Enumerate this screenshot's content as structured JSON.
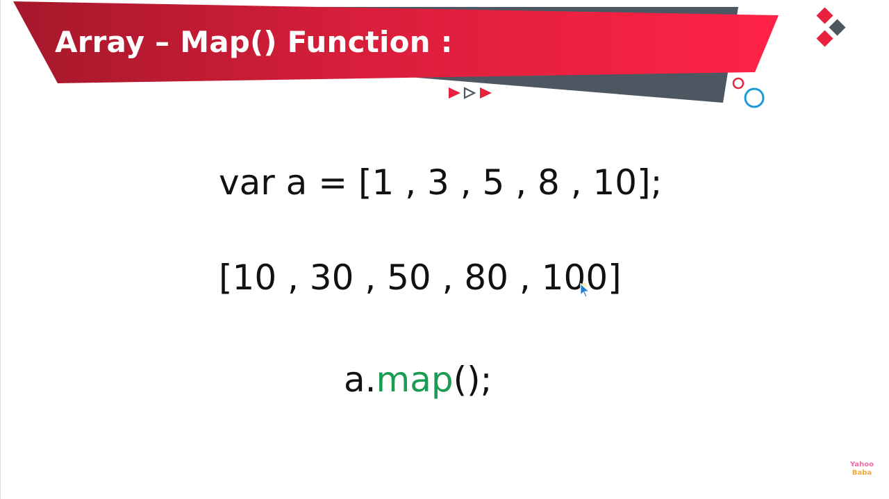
{
  "slide": {
    "title": "Array – Map() Function :",
    "code": {
      "line1": "var a = [1 , 3 , 5 , 8 , 10];",
      "line2": "[10 , 30 , 50 , 80 , 100]",
      "line3_object": "a.",
      "line3_method": "map",
      "line3_rest": "();"
    }
  },
  "logo": {
    "line1": "Yahoo",
    "line2": "Baba"
  },
  "colors": {
    "banner_red": "#e8213f",
    "banner_dark": "#4c5761",
    "method_green": "#1a9c52",
    "accent_blue": "#1a9ad6"
  },
  "icons": [
    "play-arrows-icon",
    "diamond-shapes-icon",
    "circles-icon",
    "mouse-pointer-icon"
  ]
}
